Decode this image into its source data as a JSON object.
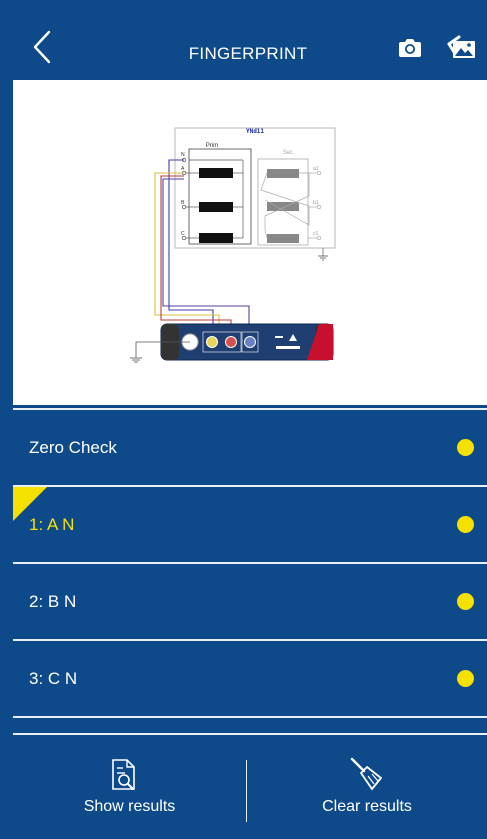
{
  "header": {
    "title": "FINGERPRINT",
    "back_icon": "chevron-left-icon",
    "camera_icon": "camera-icon",
    "gallery_icon": "gallery-icon"
  },
  "diagram": {
    "vector_group": "YNd11",
    "prim_label": "Prim",
    "sec_label": "Sec",
    "prim_terminals": [
      "N",
      "A",
      "B",
      "C"
    ],
    "sec_terminals": [
      "a1",
      "b1",
      "c1"
    ]
  },
  "tests": [
    {
      "label": "Zero Check",
      "status_color": "#f5e100",
      "active": false
    },
    {
      "label": "1: A N",
      "status_color": "#f5e100",
      "active": true
    },
    {
      "label": "2: B N",
      "status_color": "#f5e100",
      "active": false
    },
    {
      "label": "3: C N",
      "status_color": "#f5e100",
      "active": false
    }
  ],
  "footer": {
    "show_results": "Show results",
    "clear_results": "Clear results"
  },
  "colors": {
    "background": "#0e4a8a",
    "accent": "#f5e100",
    "separator": "#e8eef6"
  }
}
